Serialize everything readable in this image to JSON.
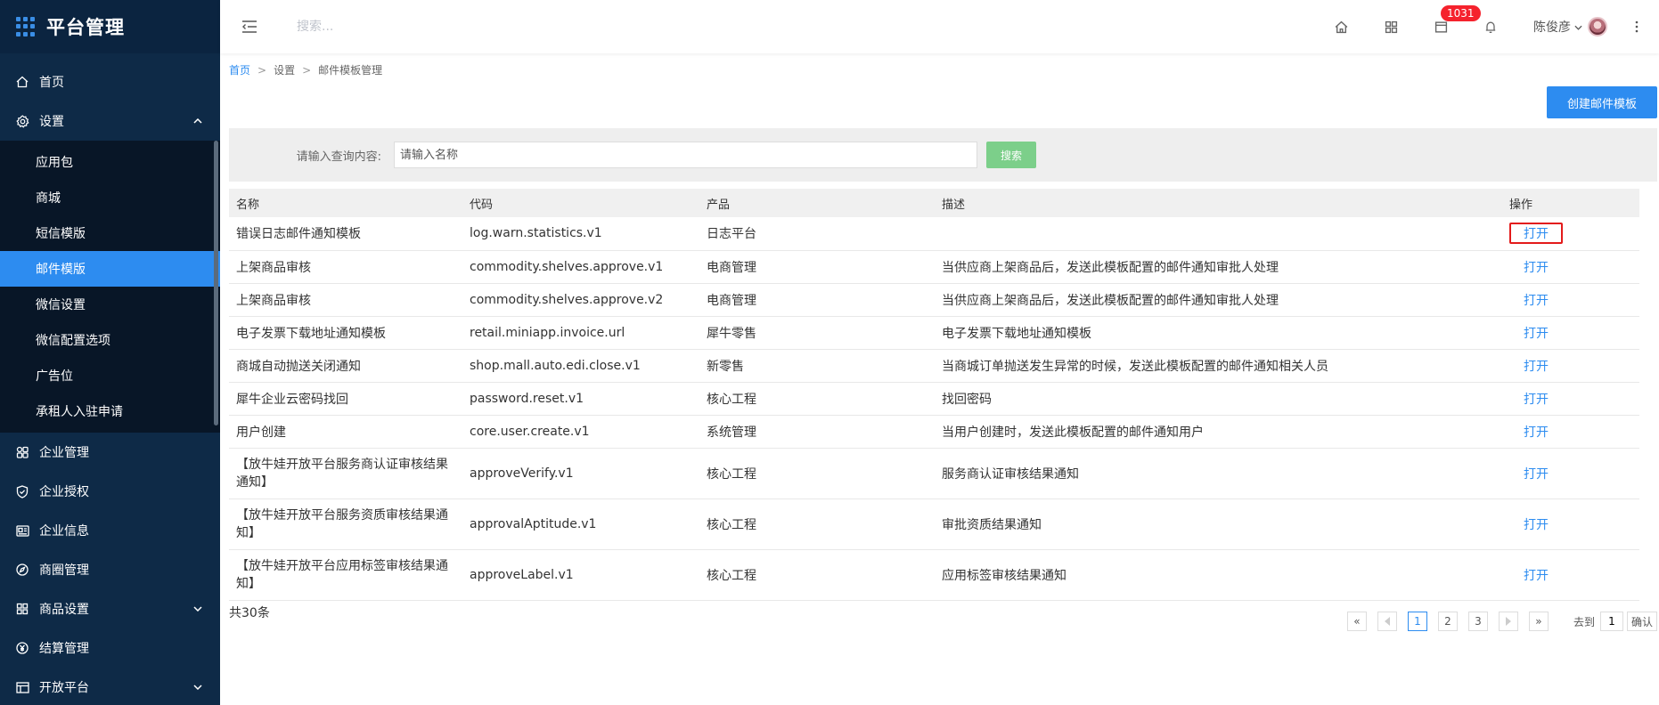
{
  "brand": {
    "title": "平台管理",
    "accent": "#2d8cf0"
  },
  "sidebar": {
    "top_items": [
      {
        "label": "首页",
        "icon": "home-icon"
      },
      {
        "label": "设置",
        "icon": "gear-icon",
        "expanded": true
      }
    ],
    "settings_sub": [
      {
        "label": "应用包"
      },
      {
        "label": "商城"
      },
      {
        "label": "短信模版"
      },
      {
        "label": "邮件模版",
        "active": true
      },
      {
        "label": "微信设置"
      },
      {
        "label": "微信配置选项"
      },
      {
        "label": "广告位"
      },
      {
        "label": "承租人入驻申请"
      }
    ],
    "bottom_items": [
      {
        "label": "企业管理",
        "icon": "grid-icon"
      },
      {
        "label": "企业授权",
        "icon": "shield-check-icon"
      },
      {
        "label": "企业信息",
        "icon": "id-card-icon"
      },
      {
        "label": "商圈管理",
        "icon": "compass-icon"
      },
      {
        "label": "商品设置",
        "icon": "apps-icon",
        "caret": "down"
      },
      {
        "label": "结算管理",
        "icon": "yen-icon"
      },
      {
        "label": "开放平台",
        "icon": "table-icon",
        "caret": "down"
      }
    ]
  },
  "header": {
    "search_placeholder": "搜索...",
    "badge_count": "1031",
    "user_name": "陈俊彦"
  },
  "breadcrumb": {
    "home": "首页",
    "level1": "设置",
    "level2": "邮件模板管理",
    "sep": ">"
  },
  "toolbar": {
    "create_label": "创建邮件模板"
  },
  "filter": {
    "label": "请输入查询内容:",
    "placeholder": "请输入名称",
    "search_label": "搜索"
  },
  "table": {
    "headers": {
      "name": "名称",
      "code": "代码",
      "product": "产品",
      "desc": "描述",
      "op": "操作"
    },
    "rows": [
      {
        "name": "错误日志邮件通知模板",
        "code": "log.warn.statistics.v1",
        "product": "日志平台",
        "desc": "",
        "op": "打开"
      },
      {
        "name": "上架商品审核",
        "code": "commodity.shelves.approve.v1",
        "product": "电商管理",
        "desc": "当供应商上架商品后，发送此模板配置的邮件通知审批人处理",
        "op": "打开"
      },
      {
        "name": "上架商品审核",
        "code": "commodity.shelves.approve.v2",
        "product": "电商管理",
        "desc": "当供应商上架商品后，发送此模板配置的邮件通知审批人处理",
        "op": "打开"
      },
      {
        "name": "电子发票下载地址通知模板",
        "code": "retail.miniapp.invoice.url",
        "product": "犀牛零售",
        "desc": "电子发票下载地址通知模板",
        "op": "打开"
      },
      {
        "name": "商城自动抛送关闭通知",
        "code": "shop.mall.auto.edi.close.v1",
        "product": "新零售",
        "desc": "当商城订单抛送发生异常的时候，发送此模板配置的邮件通知相关人员",
        "op": "打开"
      },
      {
        "name": "犀牛企业云密码找回",
        "code": "password.reset.v1",
        "product": "核心工程",
        "desc": "找回密码",
        "op": "打开"
      },
      {
        "name": "用户创建",
        "code": "core.user.create.v1",
        "product": "系统管理",
        "desc": "当用户创建时，发送此模板配置的邮件通知用户",
        "op": "打开"
      },
      {
        "name": "【放牛娃开放平台服务商认证审核结果通知】",
        "code": "approveVerify.v1",
        "product": "核心工程",
        "desc": "服务商认证审核结果通知",
        "op": "打开"
      },
      {
        "name": "【放牛娃开放平台服务资质审核结果通知】",
        "code": "approvalAptitude.v1",
        "product": "核心工程",
        "desc": "审批资质结果通知",
        "op": "打开"
      },
      {
        "name": "【放牛娃开放平台应用标签审核结果通知】",
        "code": "approveLabel.v1",
        "product": "核心工程",
        "desc": "应用标签审核结果通知",
        "op": "打开"
      }
    ]
  },
  "footer": {
    "total": "共30条"
  },
  "pager": {
    "first": "«",
    "last": "»",
    "pages": [
      "1",
      "2",
      "3"
    ],
    "current": "1",
    "goto_label": "去到",
    "goto_value": "1",
    "confirm_label": "确认"
  }
}
